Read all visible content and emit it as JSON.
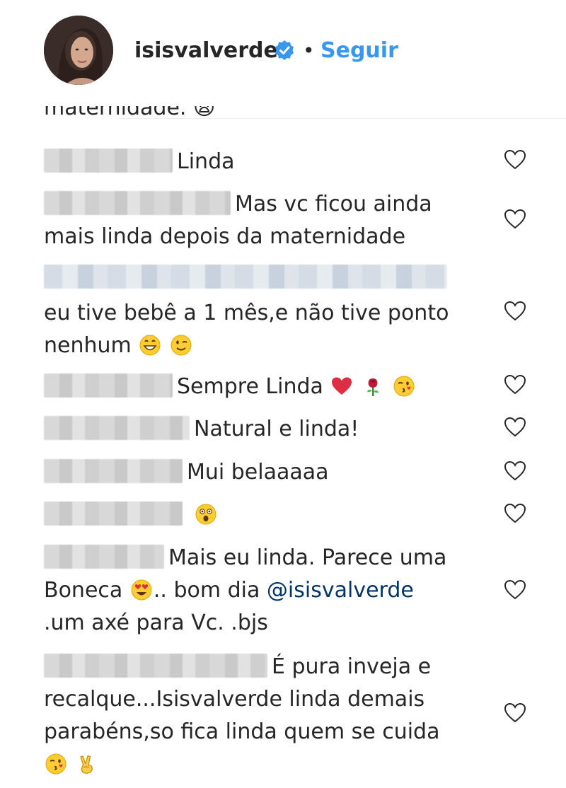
{
  "header": {
    "username": "isisvalverde",
    "separator": "•",
    "follow_label": "Seguir"
  },
  "cut_text": "maternidade. 😩",
  "comments": [
    {
      "user": "",
      "lines": [
        "Linda"
      ]
    },
    {
      "user": "",
      "lines": [
        "Mas vc ficou ainda",
        "mais linda depois da maternidade"
      ]
    },
    {
      "user": "",
      "lines": [
        "",
        "eu tive bebê a 1 mês,e não tive ponto",
        "nenhum"
      ],
      "emojis": [
        "grinning-face",
        "winking-face"
      ]
    },
    {
      "user": "",
      "lines": [
        "Sempre Linda"
      ],
      "emojis": [
        "red-heart",
        "rose",
        "face-blowing-kiss"
      ]
    },
    {
      "user": "",
      "lines": [
        "Natural e linda!"
      ]
    },
    {
      "user": "",
      "lines": [
        "Mui belaaaaa"
      ]
    },
    {
      "user": "",
      "lines": [
        ""
      ],
      "emojis": [
        "astonished-face"
      ]
    },
    {
      "user": "",
      "lines": [
        "Mais eu linda. Parece uma",
        "Boneca",
        ".. bom dia ",
        "@isisvalverde",
        ".um axé para Vc. .bjs"
      ],
      "emojis": [
        "heart-eyes-face"
      ]
    },
    {
      "user": "",
      "lines": [
        "É pura inveja e",
        "recalque...Isisvalverde linda demais",
        "parabéns,so fica linda quem se cuida"
      ],
      "emojis": [
        "face-blowing-kiss",
        "victory-hand"
      ]
    }
  ],
  "icons": {
    "verified": "verified-badge-icon",
    "like": "heart-outline-icon"
  },
  "colors": {
    "accent": "#3897f0",
    "text": "#262626",
    "mention": "#003569",
    "heart_stroke": "#262626"
  }
}
